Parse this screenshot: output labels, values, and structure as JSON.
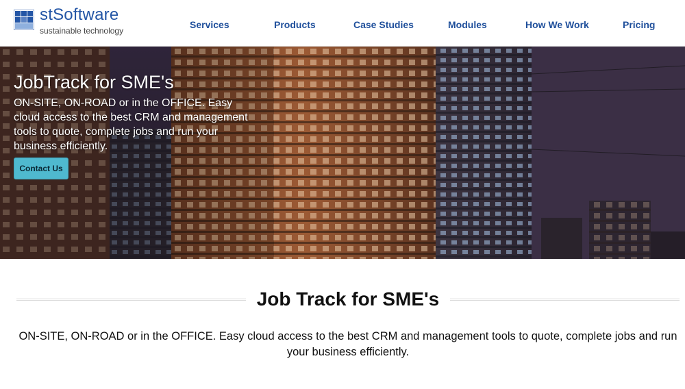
{
  "brand": {
    "name": "stSoftware",
    "tagline": "sustainable technology",
    "accent": "#2456a6"
  },
  "nav": {
    "items": [
      {
        "label": "Services"
      },
      {
        "label": "Products"
      },
      {
        "label": "Case Studies"
      },
      {
        "label": "Modules"
      },
      {
        "label": "How We Work"
      },
      {
        "label": "Pricing"
      }
    ],
    "color": "#1f4f9b"
  },
  "hero": {
    "title": "JobTrack for SME's",
    "body": "ON-SITE, ON-ROAD or in the OFFICE. Easy cloud access to the best CRM and management tools to quote, complete jobs and run your business efficiently.",
    "cta_label": "Contact Us",
    "cta_color": "#4fb9cf"
  },
  "section": {
    "title": "Job Track for SME's",
    "body": "ON-SITE, ON-ROAD or in the OFFICE. Easy cloud access to the best CRM and management tools to quote, complete jobs and run your business efficiently."
  }
}
